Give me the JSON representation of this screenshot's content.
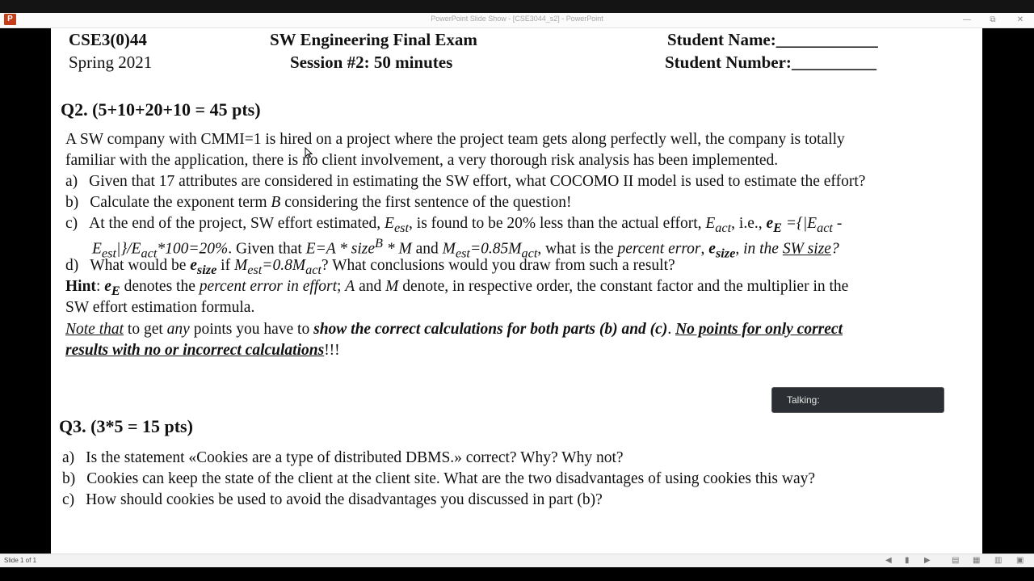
{
  "window": {
    "title": "PowerPoint Slide Show - [CSE3044_s2] - PowerPoint",
    "app_icon": "powerpoint-icon",
    "minimize": "—",
    "restore": "⧉",
    "close": "✕"
  },
  "slide": {
    "header": {
      "course_code": "CSE3(0)44",
      "term": "Spring 2021",
      "exam_title": "SW Engineering Final Exam",
      "session": "Session #2: 50 minutes",
      "student_name_label": "Student Name:",
      "student_name_blank": "____________",
      "student_number_label": "Student Number:",
      "student_number_blank": "__________"
    },
    "q2": {
      "heading": "Q2.  (5+10+20+10 = 45 pts)",
      "intro_1": "A SW company with CMMI=1 is hired on a project where the project team gets along perfectly well, the company is totally",
      "intro_2": "familiar with the application, there is no client involvement, a very thorough risk analysis has been implemented.",
      "a_label": "a)",
      "a_text": "Given that 17 attributes are considered in estimating the SW effort, what COCOMO II model is used to estimate the effort?",
      "b_label": "b)",
      "b_text_1": "Calculate the exponent term ",
      "b_var": "B",
      "b_text_2": " considering the first sentence of the question!",
      "c_label": "c)",
      "c1_text": "At the end of the project, SW effort estimated, ",
      "c1_E": "E",
      "c1_est": "est",
      "c1_text2": ", is found to be 20% less than the actual effort, ",
      "c1_E2": "E",
      "c1_act": "act",
      "c1_text3": ", i.e., ",
      "c1_e": "e",
      "c1_sub_E": "E",
      "c1_formula": " ={|E",
      "c1_act2": "act",
      "c1_dash": " -",
      "c2_E": "E",
      "c2_est": "est",
      "c2_formula1": "|}/E",
      "c2_act": "act",
      "c2_formula2": "*100=20%",
      "c2_text1": ". Given that ",
      "c2_formula3": "E=A * size",
      "c2_sup": "B",
      "c2_formula4": " * M",
      "c2_text2": " and ",
      "c2_M": "M",
      "c2_est2": "est",
      "c2_formula5": "=0.85M",
      "c2_act2": "act",
      "c2_text3": ", what is the ",
      "c2_pe": "percent error",
      "c2_comma": ", ",
      "c2_e": "e",
      "c2_size": "size",
      "c2_text4": ", in the ",
      "c2_sw_size": "SW size",
      "c2_q": "?",
      "d_label": "d)",
      "d_text1": "What would be ",
      "d_e": "e",
      "d_size": "size",
      "d_text2": " if ",
      "d_M": "M",
      "d_est": "est",
      "d_formula": "=0.8M",
      "d_act": "act",
      "d_text3": "? What conclusions would you draw from such a result?",
      "hint_label": "Hint",
      "hint_text1": ": ",
      "hint_e": "e",
      "hint_E": "E",
      "hint_text2": " denotes the ",
      "hint_pe": "percent error in effort",
      "hint_text3": "; ",
      "hint_A": "A",
      "hint_text4": " and ",
      "hint_M": "M",
      "hint_text5": " denote, in respective order, the constant factor and the multiplier in the",
      "hint_line2": "SW effort estimation formula.",
      "note_label": "Note that",
      "note_text1": " to get ",
      "note_any": "any",
      "note_text2": " points you have to ",
      "note_bold": "show the correct calculations for both parts (b) and (c)",
      "note_text3": ". ",
      "note_warn1": "No points for only correct",
      "note_warn2": "results with no or incorrect calculations",
      "note_end": "!!!"
    },
    "q3": {
      "heading": "Q3.  (3*5 = 15 pts)",
      "a_label": "a)",
      "a_text": "Is the statement «Cookies are a type of distributed DBMS.» correct? Why?  Why not?",
      "b_label": "b)",
      "b_text": "Cookies can keep the state of the client at the client site.  What are the two disadvantages of using cookies this way?",
      "c_label": "c)",
      "c_text": "How should cookies be used to avoid the disadvantages you discussed in part (b)?"
    }
  },
  "talking_popup": {
    "label": "Talking:"
  },
  "statusbar": {
    "slide_info": "Slide 1 of 1",
    "icons": [
      "previous-icon",
      "notes-icon",
      "next-icon",
      "normal-view-icon",
      "slide-sorter-icon",
      "reading-view-icon",
      "slideshow-icon"
    ]
  }
}
